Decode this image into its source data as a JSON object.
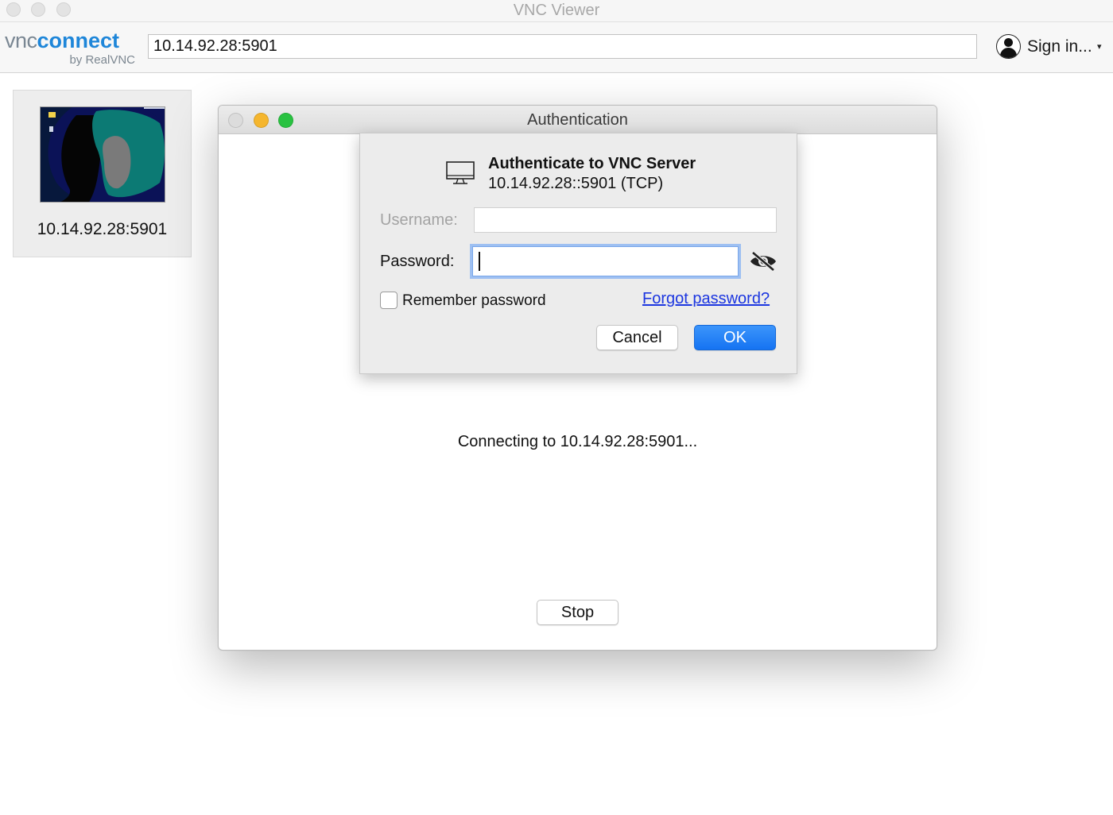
{
  "window": {
    "title": "VNC Viewer"
  },
  "toolbar": {
    "brand_vnc": "vnc",
    "brand_connect": "connect",
    "brand_by": "by RealVNC",
    "address_value": "10.14.92.28:5901",
    "signin_label": "Sign in...",
    "signin_caret": "▾"
  },
  "address_book": {
    "tiles": [
      {
        "label": "10.14.92.28:5901"
      }
    ]
  },
  "connection_window": {
    "title": "Authentication",
    "status": "Connecting to 10.14.92.28:5901...",
    "stop_label": "Stop"
  },
  "auth_dialog": {
    "heading": "Authenticate to VNC Server",
    "server": "10.14.92.28::5901 (TCP)",
    "username_label": "Username:",
    "username_value": "",
    "password_label": "Password:",
    "password_value": "",
    "remember_label": "Remember password",
    "remember_checked": false,
    "forgot_label": "Forgot password?",
    "cancel_label": "Cancel",
    "ok_label": "OK"
  },
  "colors": {
    "accent_blue": "#1573f2",
    "link_blue": "#1c36e0",
    "brand_blue": "#1e86d9",
    "close_gray": "#dcdcdc",
    "minimize_yellow": "#f5b62e",
    "maximize_green": "#29c241"
  },
  "icons": {
    "user": "user-avatar-icon",
    "monitor": "monitor-icon",
    "password_visibility": "eye-slash-icon"
  }
}
